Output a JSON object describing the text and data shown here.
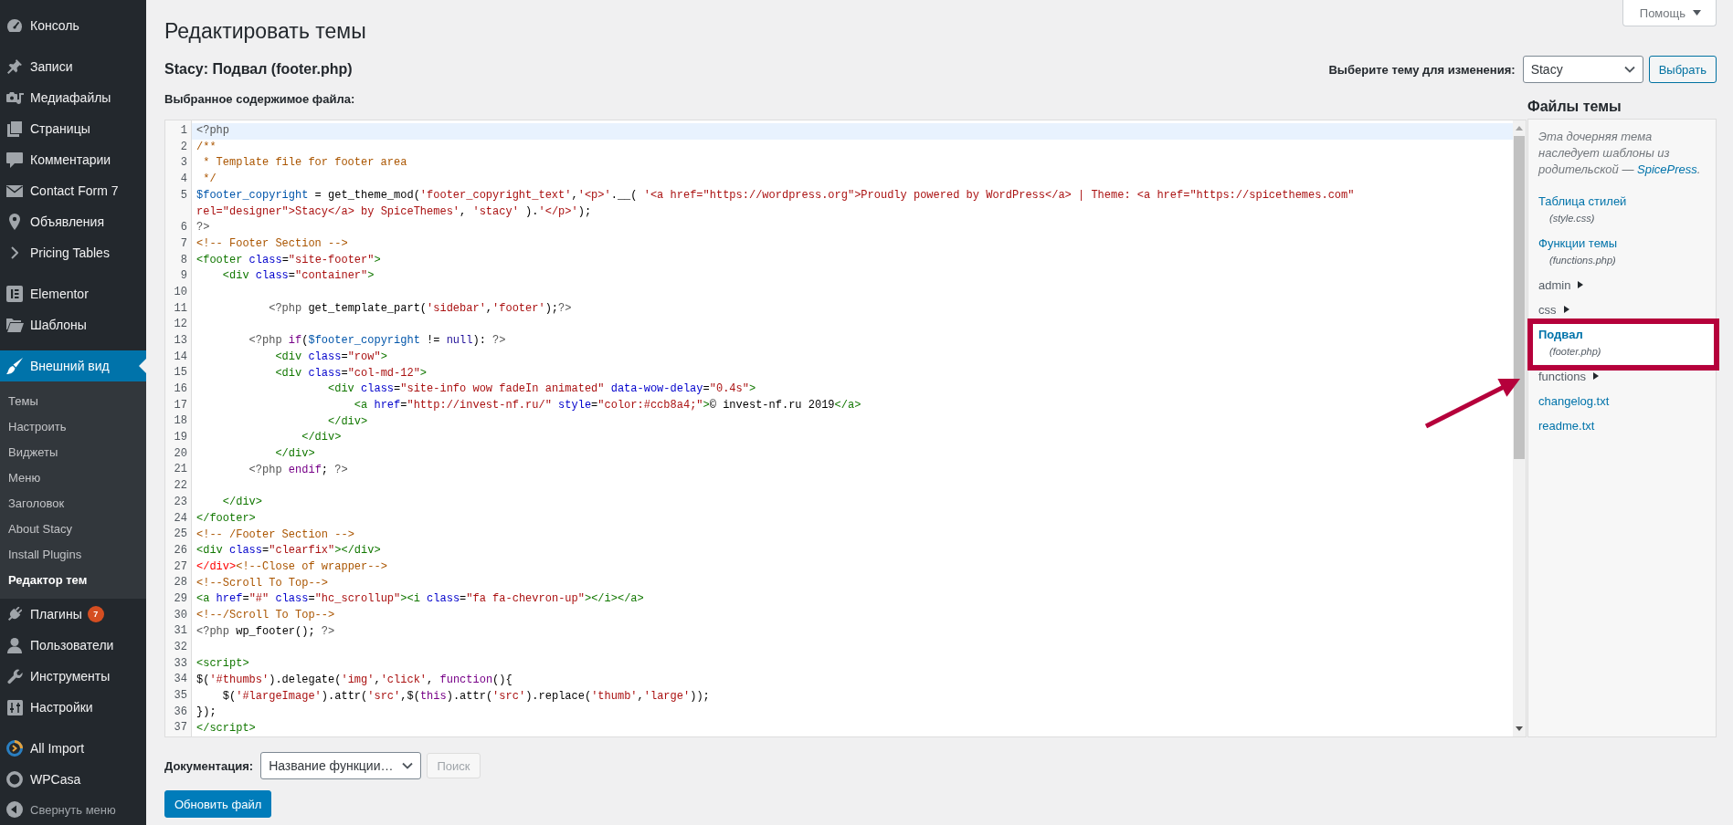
{
  "sidebar": {
    "sections": [
      {
        "items": [
          {
            "label": "Консоль",
            "selected": false
          }
        ]
      },
      {
        "items": [
          {
            "label": "Записи",
            "selected": false
          },
          {
            "label": "Медиафайлы",
            "selected": false
          },
          {
            "label": "Страницы",
            "selected": false
          },
          {
            "label": "Комментарии",
            "selected": false
          },
          {
            "label": "Contact Form 7",
            "selected": false
          },
          {
            "label": "Объявления",
            "selected": false
          },
          {
            "label": "Pricing Tables",
            "selected": false
          }
        ]
      },
      {
        "items": [
          {
            "label": "Elementor",
            "selected": false
          },
          {
            "label": "Шаблоны",
            "selected": false
          }
        ]
      },
      {
        "items": [
          {
            "label": "Внешний вид",
            "selected": true,
            "submenu": [
              {
                "label": "Темы",
                "selected": false
              },
              {
                "label": "Настроить",
                "selected": false
              },
              {
                "label": "Виджеты",
                "selected": false
              },
              {
                "label": "Меню",
                "selected": false
              },
              {
                "label": "Заголовок",
                "selected": false
              },
              {
                "label": "About Stacy",
                "selected": false
              },
              {
                "label": "Install Plugins",
                "selected": false
              },
              {
                "label": "Редактор тем",
                "selected": true
              }
            ]
          },
          {
            "label": "Плагины",
            "selected": false,
            "badge": "7"
          },
          {
            "label": "Пользователи",
            "selected": false
          },
          {
            "label": "Инструменты",
            "selected": false
          },
          {
            "label": "Настройки",
            "selected": false
          }
        ]
      },
      {
        "items": [
          {
            "label": "All Import",
            "selected": false
          },
          {
            "label": "WPCasa",
            "selected": false
          }
        ]
      }
    ],
    "collapse_label": "Свернуть меню"
  },
  "help_button": {
    "label": "Помощь"
  },
  "page_title": "Редактировать темы",
  "file_heading": "Stacy: Подвал (footer.php)",
  "theme_picker": {
    "label": "Выберите тему для изменения:",
    "value": "Stacy",
    "button": "Выбрать"
  },
  "editor": {
    "label": "Выбранное содержимое файла:",
    "lines": [
      {
        "number": "1",
        "active": true,
        "tokens": [
          {
            "kind": "meta",
            "text": "<?php"
          }
        ]
      },
      {
        "number": "2",
        "active": false,
        "tokens": [
          {
            "kind": "comment",
            "text": "/**"
          }
        ]
      },
      {
        "number": "3",
        "active": false,
        "tokens": [
          {
            "kind": "comment",
            "text": " * Template file for footer area"
          }
        ]
      },
      {
        "number": "4",
        "active": false,
        "tokens": [
          {
            "kind": "comment",
            "text": " */"
          }
        ]
      },
      {
        "number": "5",
        "active": false,
        "tokens": [
          {
            "kind": "variable",
            "text": "$footer_copyright"
          },
          {
            "kind": "plain",
            "text": " = get_theme_mod("
          },
          {
            "kind": "string",
            "text": "'footer_copyright_text'"
          },
          {
            "kind": "plain",
            "text": ","
          },
          {
            "kind": "string",
            "text": "'<p>'"
          },
          {
            "kind": "plain",
            "text": ".__( "
          },
          {
            "kind": "string",
            "text": "'<a href=\"https://wordpress.org\">Proudly powered by WordPress</a> | Theme: <a href=\"https://spicethemes.com\""
          }
        ],
        "continued": [
          {
            "kind": "string",
            "text": "rel=\"designer\">Stacy</a> by SpiceThemes'"
          },
          {
            "kind": "plain",
            "text": ", "
          },
          {
            "kind": "string",
            "text": "'stacy'"
          },
          {
            "kind": "plain",
            "text": " )."
          },
          {
            "kind": "string",
            "text": "'</p>'"
          },
          {
            "kind": "plain",
            "text": ");"
          }
        ]
      },
      {
        "number": "6",
        "active": false,
        "tokens": [
          {
            "kind": "meta",
            "text": "?>"
          }
        ]
      },
      {
        "number": "7",
        "active": false,
        "tokens": [
          {
            "kind": "comment",
            "text": "<!-- Footer Section -->"
          }
        ]
      },
      {
        "number": "8",
        "active": false,
        "tokens": [
          {
            "kind": "tag",
            "text": "<footer"
          },
          {
            "kind": "attribute",
            "text": " class"
          },
          {
            "kind": "plain",
            "text": "="
          },
          {
            "kind": "string",
            "text": "\"site-footer\""
          },
          {
            "kind": "tag",
            "text": ">"
          }
        ]
      },
      {
        "number": "9",
        "active": false,
        "tokens": [
          {
            "kind": "tag",
            "text": "    <div"
          },
          {
            "kind": "attribute",
            "text": " class"
          },
          {
            "kind": "plain",
            "text": "="
          },
          {
            "kind": "string",
            "text": "\"container\""
          },
          {
            "kind": "tag",
            "text": ">"
          }
        ]
      },
      {
        "number": "10",
        "active": false
      },
      {
        "number": "11",
        "active": false,
        "tokens": [
          {
            "kind": "meta",
            "text": "           <?php"
          },
          {
            "kind": "plain",
            "text": " get_template_part("
          },
          {
            "kind": "string",
            "text": "'sidebar'"
          },
          {
            "kind": "plain",
            "text": ","
          },
          {
            "kind": "string",
            "text": "'footer'"
          },
          {
            "kind": "plain",
            "text": ");"
          },
          {
            "kind": "meta",
            "text": "?>"
          }
        ]
      },
      {
        "number": "12",
        "active": false
      },
      {
        "number": "13",
        "active": false,
        "tokens": [
          {
            "kind": "meta",
            "text": "        <?php"
          },
          {
            "kind": "keyword",
            "text": " if"
          },
          {
            "kind": "plain",
            "text": "("
          },
          {
            "kind": "variable",
            "text": "$footer_copyright"
          },
          {
            "kind": "plain",
            "text": " != "
          },
          {
            "kind": "atom",
            "text": "null"
          },
          {
            "kind": "plain",
            "text": "): "
          },
          {
            "kind": "meta",
            "text": "?>"
          }
        ]
      },
      {
        "number": "14",
        "active": false,
        "tokens": [
          {
            "kind": "tag",
            "text": "            <div"
          },
          {
            "kind": "attribute",
            "text": " class"
          },
          {
            "kind": "plain",
            "text": "="
          },
          {
            "kind": "string",
            "text": "\"row\""
          },
          {
            "kind": "tag",
            "text": ">"
          }
        ]
      },
      {
        "number": "15",
        "active": false,
        "tokens": [
          {
            "kind": "tag",
            "text": "            <div"
          },
          {
            "kind": "attribute",
            "text": " class"
          },
          {
            "kind": "plain",
            "text": "="
          },
          {
            "kind": "string",
            "text": "\"col-md-12\""
          },
          {
            "kind": "tag",
            "text": ">"
          }
        ]
      },
      {
        "number": "16",
        "active": false,
        "tokens": [
          {
            "kind": "tag",
            "text": "                    <div"
          },
          {
            "kind": "attribute",
            "text": " class"
          },
          {
            "kind": "plain",
            "text": "="
          },
          {
            "kind": "string",
            "text": "\"site-info wow fadeIn animated\""
          },
          {
            "kind": "attribute",
            "text": " data-wow-delay"
          },
          {
            "kind": "plain",
            "text": "="
          },
          {
            "kind": "string",
            "text": "\"0.4s\""
          },
          {
            "kind": "tag",
            "text": ">"
          }
        ]
      },
      {
        "number": "17",
        "active": false,
        "tokens": [
          {
            "kind": "tag",
            "text": "                        <a"
          },
          {
            "kind": "attribute",
            "text": " href"
          },
          {
            "kind": "plain",
            "text": "="
          },
          {
            "kind": "string",
            "text": "\"http://invest-nf.ru/\""
          },
          {
            "kind": "attribute",
            "text": " style"
          },
          {
            "kind": "plain",
            "text": "="
          },
          {
            "kind": "string",
            "text": "\"color:#ccb8a4;\""
          },
          {
            "kind": "tag",
            "text": ">"
          },
          {
            "kind": "plain",
            "text": "© invest-nf.ru 2019"
          },
          {
            "kind": "tag",
            "text": "</a>"
          }
        ]
      },
      {
        "number": "18",
        "active": false,
        "tokens": [
          {
            "kind": "tag",
            "text": "                    </div>"
          }
        ]
      },
      {
        "number": "19",
        "active": false,
        "tokens": [
          {
            "kind": "tag",
            "text": "                </div>"
          }
        ]
      },
      {
        "number": "20",
        "active": false,
        "tokens": [
          {
            "kind": "tag",
            "text": "            </div>"
          }
        ]
      },
      {
        "number": "21",
        "active": false,
        "tokens": [
          {
            "kind": "meta",
            "text": "        <?php"
          },
          {
            "kind": "keyword",
            "text": " endif"
          },
          {
            "kind": "plain",
            "text": "; "
          },
          {
            "kind": "meta",
            "text": "?>"
          }
        ]
      },
      {
        "number": "22",
        "active": false
      },
      {
        "number": "23",
        "active": false,
        "tokens": [
          {
            "kind": "tag",
            "text": "    </div>"
          }
        ]
      },
      {
        "number": "24",
        "active": false,
        "tokens": [
          {
            "kind": "tag",
            "text": "</footer>"
          }
        ]
      },
      {
        "number": "25",
        "active": false,
        "tokens": [
          {
            "kind": "comment",
            "text": "<!-- /Footer Section -->"
          }
        ]
      },
      {
        "number": "26",
        "active": false,
        "tokens": [
          {
            "kind": "tag",
            "text": "<div"
          },
          {
            "kind": "attribute",
            "text": " class"
          },
          {
            "kind": "plain",
            "text": "="
          },
          {
            "kind": "string",
            "text": "\"clearfix\""
          },
          {
            "kind": "tag",
            "text": "></div>"
          }
        ]
      },
      {
        "number": "27",
        "active": false,
        "tokens": [
          {
            "kind": "error",
            "text": "</div>"
          },
          {
            "kind": "comment",
            "text": "<!--Close of wrapper-->"
          }
        ]
      },
      {
        "number": "28",
        "active": false,
        "tokens": [
          {
            "kind": "comment",
            "text": "<!--Scroll To Top-->"
          }
        ]
      },
      {
        "number": "29",
        "active": false,
        "tokens": [
          {
            "kind": "tag",
            "text": "<a"
          },
          {
            "kind": "attribute",
            "text": " href"
          },
          {
            "kind": "plain",
            "text": "="
          },
          {
            "kind": "string",
            "text": "\"#\""
          },
          {
            "kind": "attribute",
            "text": " class"
          },
          {
            "kind": "plain",
            "text": "="
          },
          {
            "kind": "string",
            "text": "\"hc_scrollup\""
          },
          {
            "kind": "tag",
            "text": "><i"
          },
          {
            "kind": "attribute",
            "text": " class"
          },
          {
            "kind": "plain",
            "text": "="
          },
          {
            "kind": "string",
            "text": "\"fa fa-chevron-up\""
          },
          {
            "kind": "tag",
            "text": "></i></a>"
          }
        ]
      },
      {
        "number": "30",
        "active": false,
        "tokens": [
          {
            "kind": "comment",
            "text": "<!--/Scroll To Top-->"
          }
        ]
      },
      {
        "number": "31",
        "active": false,
        "tokens": [
          {
            "kind": "meta",
            "text": "<?php"
          },
          {
            "kind": "plain",
            "text": " wp_footer(); "
          },
          {
            "kind": "meta",
            "text": "?>"
          }
        ]
      },
      {
        "number": "32",
        "active": false
      },
      {
        "number": "33",
        "active": false,
        "tokens": [
          {
            "kind": "tag",
            "text": "<script>"
          }
        ]
      },
      {
        "number": "34",
        "active": false,
        "tokens": [
          {
            "kind": "plain",
            "text": "$("
          },
          {
            "kind": "string",
            "text": "'#thumbs'"
          },
          {
            "kind": "plain",
            "text": ").delegate("
          },
          {
            "kind": "string",
            "text": "'img'"
          },
          {
            "kind": "plain",
            "text": ","
          },
          {
            "kind": "string",
            "text": "'click'"
          },
          {
            "kind": "plain",
            "text": ", "
          },
          {
            "kind": "keyword",
            "text": "function"
          },
          {
            "kind": "plain",
            "text": "(){"
          }
        ]
      },
      {
        "number": "35",
        "active": false,
        "tokens": [
          {
            "kind": "plain",
            "text": "    $("
          },
          {
            "kind": "string",
            "text": "'#largeImage'"
          },
          {
            "kind": "plain",
            "text": ").attr("
          },
          {
            "kind": "string",
            "text": "'src'"
          },
          {
            "kind": "plain",
            "text": ",$("
          },
          {
            "kind": "keyword",
            "text": "this"
          },
          {
            "kind": "plain",
            "text": ").attr("
          },
          {
            "kind": "string",
            "text": "'src'"
          },
          {
            "kind": "plain",
            "text": ").replace("
          },
          {
            "kind": "string",
            "text": "'thumb'"
          },
          {
            "kind": "plain",
            "text": ","
          },
          {
            "kind": "string",
            "text": "'large'"
          },
          {
            "kind": "plain",
            "text": "));"
          }
        ]
      },
      {
        "number": "36",
        "active": false,
        "tokens": [
          {
            "kind": "plain",
            "text": "});"
          }
        ]
      },
      {
        "number": "37",
        "active": false,
        "tokens": [
          {
            "kind": "tag",
            "text": "</script>"
          }
        ]
      }
    ]
  },
  "theme_files": {
    "heading": "Файлы темы",
    "note": {
      "text": "Эта дочерняя тема наследует шаблоны из родительской — ",
      "link": "SpicePress",
      "text_after": "."
    },
    "items": [
      {
        "kind": "file",
        "label": "Таблица стилей",
        "file": "(style.css)",
        "selected": false
      },
      {
        "kind": "file",
        "label": "Функции темы",
        "file": "(functions.php)",
        "selected": false
      },
      {
        "kind": "folder",
        "label": "admin",
        "expanded": false,
        "selected": false
      },
      {
        "kind": "folder",
        "label": "css",
        "expanded": false,
        "selected": false
      },
      {
        "kind": "file",
        "label": "Подвал",
        "file": "(footer.php)",
        "selected": true
      },
      {
        "kind": "folder",
        "label": "functions",
        "expanded": false,
        "selected": false
      },
      {
        "kind": "file",
        "label": "changelog.txt",
        "selected": false
      },
      {
        "kind": "file",
        "label": "readme.txt",
        "selected": false
      }
    ]
  },
  "documentation": {
    "label": "Документация:",
    "value": "Название функции…",
    "search_button": {
      "label": "Поиск",
      "disabled": true
    }
  },
  "update_button": {
    "label": "Обновить файл"
  },
  "annotation": {
    "frame": true,
    "arrow": true
  }
}
